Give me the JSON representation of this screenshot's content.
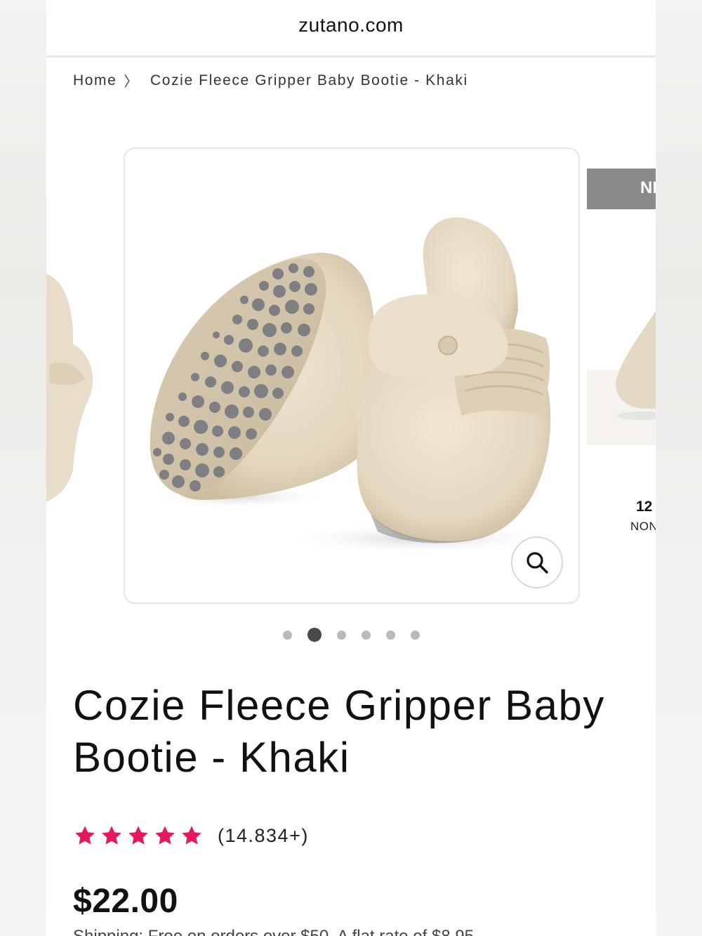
{
  "browser": {
    "url": "zutano.com"
  },
  "breadcrumb": {
    "home": "Home",
    "current": "Cozie Fleece Gripper Baby Bootie - Khaki"
  },
  "gallery": {
    "slide_count": 6,
    "active_index": 1,
    "next_badge": "NE",
    "next_age": "12",
    "next_sub": "NON"
  },
  "product": {
    "title": "Cozie Fleece Gripper Baby Bootie - Khaki",
    "rating": 5,
    "review_count": "(14.834+)",
    "price": "$22.00",
    "shipping_fragment": "Shipping: Free on orders over $50. A flat rate of $8.95"
  },
  "colors": {
    "star": "#e8185f",
    "fleece": "#e6dac4",
    "sole": "#7e7f83"
  },
  "icons": {
    "zoom": "magnifier-icon"
  }
}
